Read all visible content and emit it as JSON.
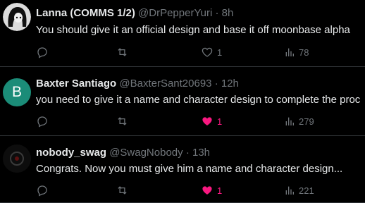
{
  "tweets": [
    {
      "name": "Lanna (COMMS 1/2)",
      "handle": "@DrPepperYuri",
      "time": "8h",
      "text": "You should give it an official design and base it off moonbase alpha",
      "likes": "1",
      "liked": false,
      "views": "78"
    },
    {
      "avatar_letter": "B",
      "name": "Baxter Santiago",
      "handle": "@BaxterSant20693",
      "time": "12h",
      "text": "you need to give it a name and character design to complete the proc",
      "likes": "1",
      "liked": true,
      "views": "279"
    },
    {
      "name": "nobody_swag",
      "handle": "@SwagNobody",
      "time": "13h",
      "text": "Congrats. Now you must give him a name and character design...",
      "likes": "1",
      "liked": true,
      "views": "221"
    }
  ],
  "separator": "·",
  "colors": {
    "background": "#000000",
    "text": "#e7e9ea",
    "muted": "#71767b",
    "like_active": "#f91880",
    "avatar_b": "#1b8c78"
  }
}
